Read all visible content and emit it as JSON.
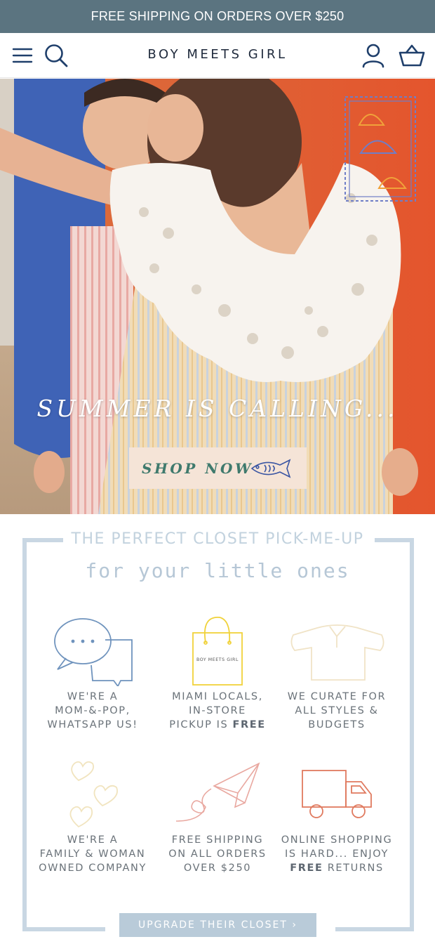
{
  "announcement": {
    "text": "FREE SHIPPING ON ORDERS OVER $250"
  },
  "header": {
    "brand": "BOY MEETS GIRL",
    "icons": [
      "menu-icon",
      "search-icon",
      "account-icon",
      "cart-icon"
    ]
  },
  "hero": {
    "title": "SUMMER IS CALLING...",
    "button_label": "SHOP NOW",
    "button_icon": "fish-icon"
  },
  "section": {
    "title": "THE PERFECT CLOSET PICK-ME-UP",
    "subtitle": "for your little ones",
    "features": [
      {
        "icon": "chat-bubbles-icon",
        "lines": [
          "WE'RE A",
          "MOM-&-POP,",
          "WHATSAPP US!"
        ]
      },
      {
        "icon": "shopping-bag-icon",
        "bag_text": "BOY MEETS GIRL",
        "lines": [
          "MIAMI LOCALS,",
          "IN-STORE"
        ],
        "last_prefix": "PICKUP IS ",
        "last_bold": "FREE"
      },
      {
        "icon": "shirt-icon",
        "lines": [
          "WE CURATE FOR",
          "ALL STYLES &",
          "BUDGETS"
        ]
      },
      {
        "icon": "hearts-icon",
        "lines": [
          "WE'RE A",
          "FAMILY & WOMAN",
          "OWNED COMPANY"
        ]
      },
      {
        "icon": "paper-plane-icon",
        "lines": [
          "FREE SHIPPING",
          "ON ALL ORDERS",
          "OVER $250"
        ]
      },
      {
        "icon": "delivery-truck-icon",
        "lines": [
          "ONLINE SHOPPING",
          "IS HARD... ENJOY"
        ],
        "last_bold": "FREE",
        "last_suffix": " RETURNS"
      }
    ],
    "cta_label": "UPGRADE THEIR CLOSET ›"
  },
  "colors": {
    "announcement_bg": "#5b7480",
    "hero_button_bg": "#f5e4d7",
    "hero_button_text": "#3f7a6d",
    "frame": "#c9d7e3",
    "cta_bg": "#b9cbd9"
  }
}
